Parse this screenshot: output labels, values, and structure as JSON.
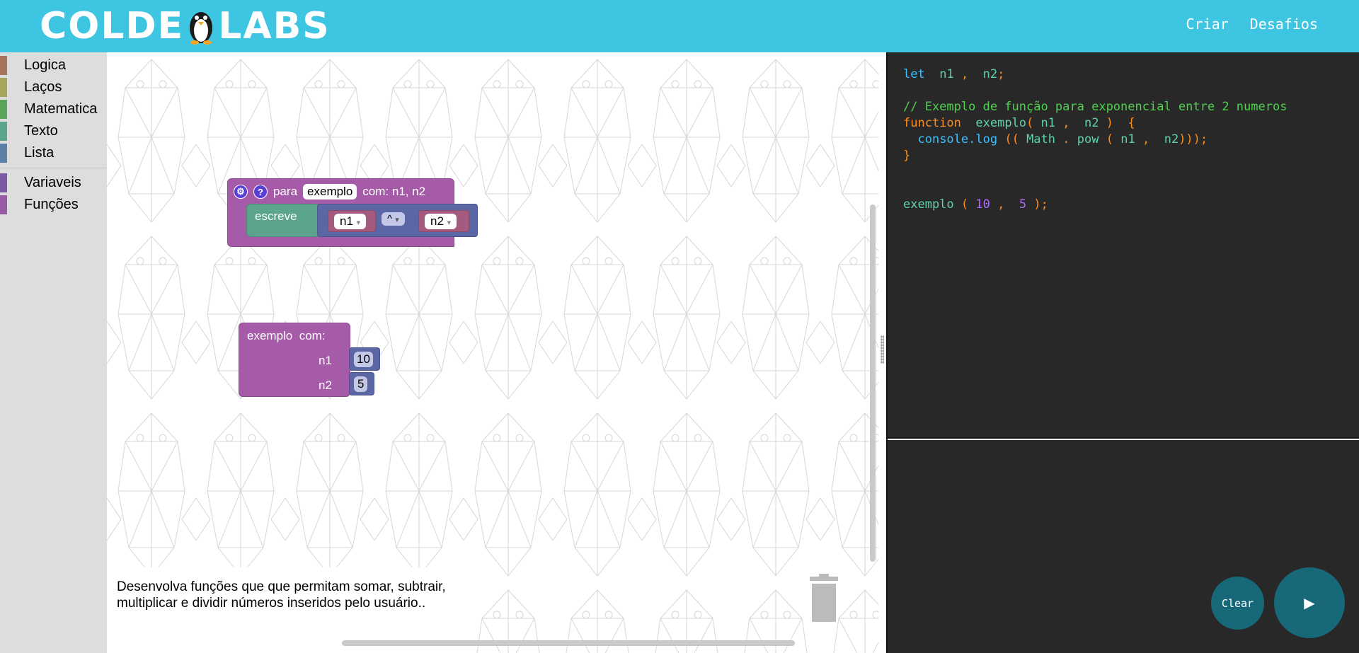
{
  "header": {
    "logo_text_left": "COLDE",
    "logo_text_right": "LABS",
    "nav": [
      "Criar",
      "Desafios"
    ]
  },
  "toolbox": {
    "categories": [
      {
        "label": "Logica",
        "color": "#a5745b"
      },
      {
        "label": "Laços",
        "color": "#a5a55b"
      },
      {
        "label": "Matematica",
        "color": "#5ba55b"
      },
      {
        "label": "Texto",
        "color": "#5ba58c"
      },
      {
        "label": "Lista",
        "color": "#5b80a5"
      }
    ],
    "variables": [
      {
        "label": "Variaveis",
        "color": "#7b5ba5"
      },
      {
        "label": "Funções",
        "color": "#995ba5"
      }
    ]
  },
  "blocks": {
    "function_def": {
      "gear_icon": "gear-icon",
      "help_icon": "?",
      "para": "para",
      "name": "exemplo",
      "params": "com: n1, n2",
      "print": "escreve",
      "left_var": "n1",
      "operator": "^",
      "right_var": "n2",
      "dropdown_glyph": "▾"
    },
    "function_call": {
      "title": "exemplo  com:",
      "arg1_label": "n1",
      "arg1_value": "10",
      "arg2_label": "n2",
      "arg2_value": "5"
    }
  },
  "hint": "Desenvolva funções que que permitam somar, subtrair, multiplicar e dividir números inseridos pelo usuário..",
  "code": {
    "line1": [
      "let",
      "n1",
      ",",
      "n2",
      ";"
    ],
    "comment": "// Exemplo de função para exponencial entre 2 numeros",
    "fn_kw": "function",
    "fn_name": "exemplo",
    "p_open": "(",
    "p1": "n1",
    "comma": ",",
    "p2": "n2",
    "p_close": ")",
    "brace_open": "{",
    "console": "console.log",
    "pp_open": "((",
    "math": "Math",
    "dot": ".",
    "pow": "pow",
    "inner_close": ")));",
    "brace_close": "}",
    "call_name": "exemplo",
    "arg1": "10",
    "arg2": "5",
    "call_end": ");"
  },
  "controls": {
    "clear_label": "Clear",
    "run_icon": "▶"
  }
}
